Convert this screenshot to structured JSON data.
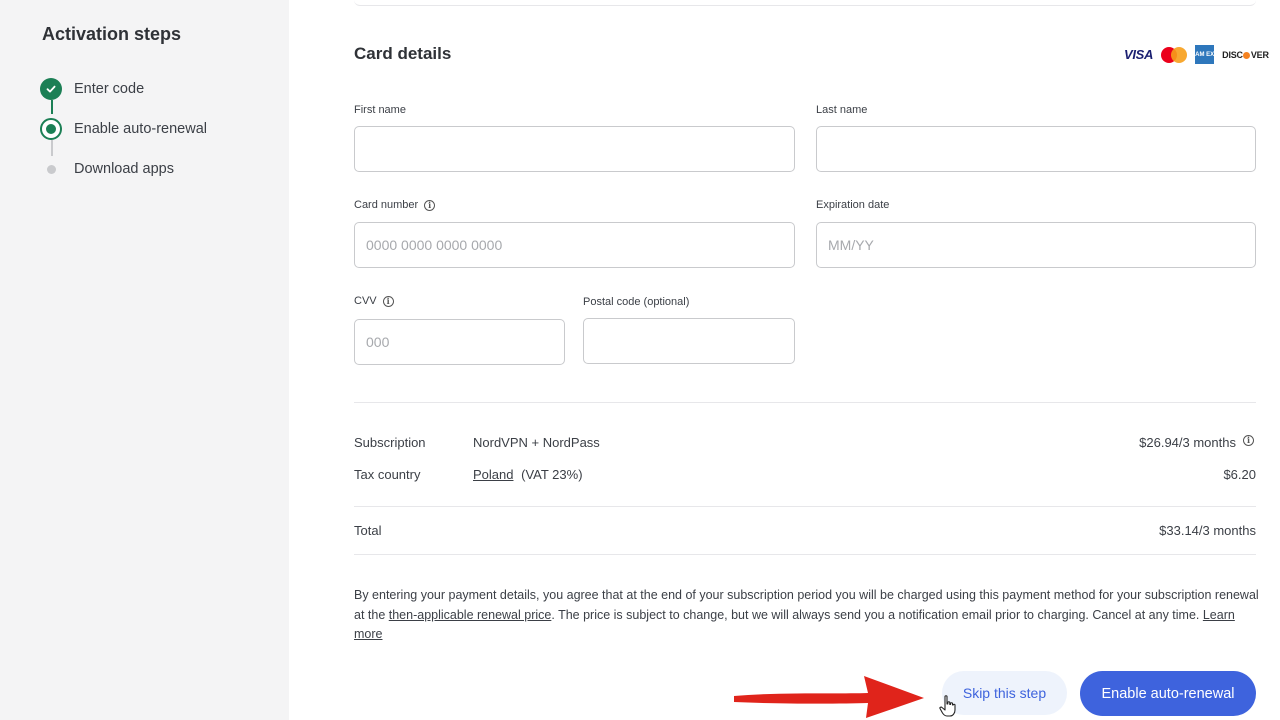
{
  "sidebar": {
    "title": "Activation steps",
    "steps": [
      {
        "label": "Enter code",
        "state": "done"
      },
      {
        "label": "Enable auto-renewal",
        "state": "active"
      },
      {
        "label": "Download apps",
        "state": "pending"
      }
    ]
  },
  "card": {
    "title": "Card details",
    "brand_icons": [
      "visa-logo",
      "mastercard-logo",
      "amex-logo",
      "discover-logo"
    ],
    "brand_text": {
      "visa": "VISA",
      "amex": "AM EX",
      "discover_pre": "DISC",
      "discover_post": "VER"
    },
    "fields": {
      "first_name": {
        "label": "First name",
        "value": "",
        "placeholder": ""
      },
      "last_name": {
        "label": "Last name",
        "value": "",
        "placeholder": ""
      },
      "card_number": {
        "label": "Card number",
        "value": "",
        "placeholder": "0000 0000 0000 0000"
      },
      "expiration": {
        "label": "Expiration date",
        "value": "",
        "placeholder": "MM/YY"
      },
      "cvv": {
        "label": "CVV",
        "value": "",
        "placeholder": "000"
      },
      "postal": {
        "label": "Postal code (optional)",
        "value": "",
        "placeholder": ""
      }
    }
  },
  "summary": {
    "subscription_label": "Subscription",
    "subscription_value": "NordVPN + NordPass",
    "subscription_price": "$26.94/3 months",
    "tax_label": "Tax country",
    "tax_country": "Poland",
    "tax_rate": "(VAT 23%)",
    "tax_amount": "$6.20",
    "total_label": "Total",
    "total_price": "$33.14/3 months"
  },
  "legal": {
    "part1": "By entering your payment details, you agree that at the end of your subscription period you will be charged using this payment method for your subscription renewal at the ",
    "link1": "then-applicable renewal price",
    "part2": ". The price is subject to change, but we will always send you a notification email prior to charging. Cancel at any time. ",
    "link2": "Learn more"
  },
  "actions": {
    "skip_label": "Skip this step",
    "enable_label": "Enable auto-renewal"
  },
  "colors": {
    "accent": "#3e63dd",
    "success": "#1b7f55",
    "annotation_arrow": "#e0241b"
  }
}
